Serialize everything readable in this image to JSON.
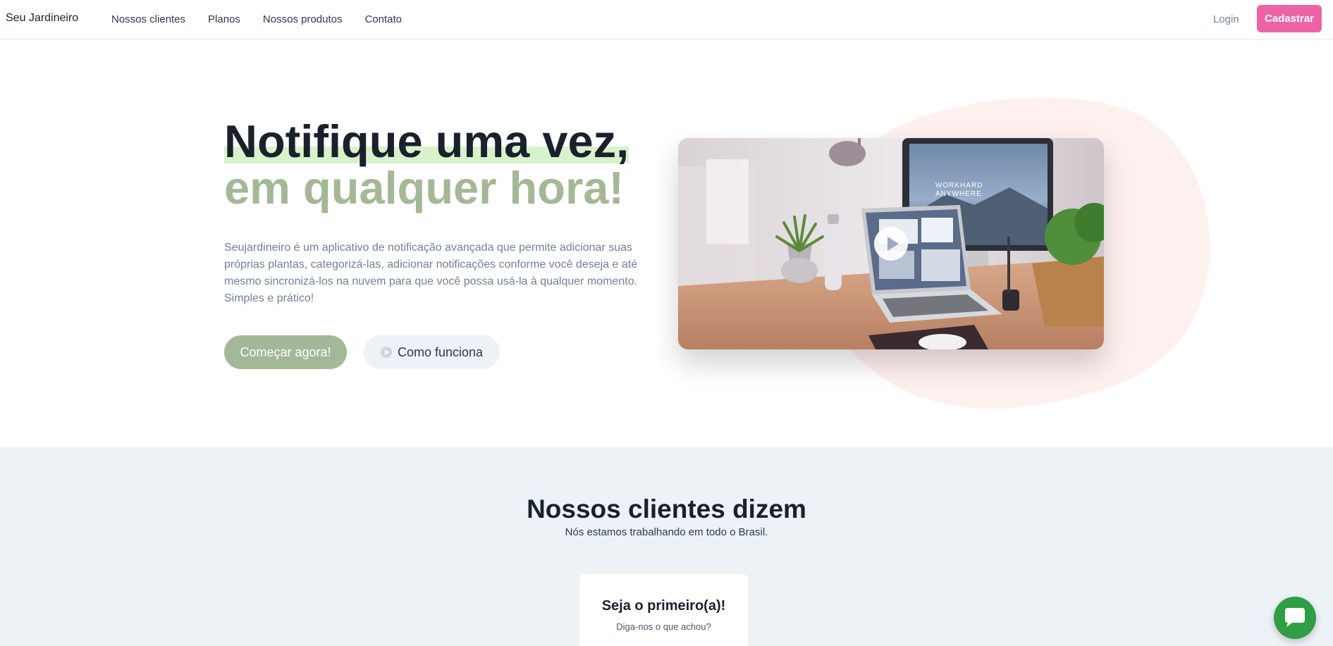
{
  "navbar": {
    "brand": "Seu Jardineiro",
    "links": [
      "Nossos clientes",
      "Planos",
      "Nossos produtos",
      "Contato"
    ],
    "login": "Login",
    "signup": "Cadastrar"
  },
  "hero": {
    "title_line1": "Notifique uma vez,",
    "title_line2": "em qualquer hora!",
    "description": "Seujardineiro é um aplicativo de notificação avançada que permite adicionar suas próprias plantas, categorizá-las, adicionar notificações conforme você deseja e até mesmo sincronizá-los na nuvem para que você possa usá-la à qualquer momento. Simples e prático!",
    "cta_primary": "Começar agora!",
    "cta_secondary": "Como funciona",
    "video_screen_text": "WORKHARD ANYWHERE"
  },
  "clients": {
    "title": "Nossos clientes dizem",
    "subtitle": "Nós estamos trabalhando em todo o Brasil.",
    "card": {
      "title": "Seja o primeiro(a)!",
      "subtitle": "Diga-nos o que achou?"
    }
  },
  "colors": {
    "accent_pink": "#ed64a6",
    "sage_green": "#a3b897",
    "highlight_green": "#d8f2cb",
    "blob_pink": "#fdf0ee",
    "section_gray": "#edf2f7",
    "chat_green": "#2f9e44"
  },
  "icons": {
    "play_button": "play-icon",
    "chat_button": "chat-bubble-icon"
  }
}
